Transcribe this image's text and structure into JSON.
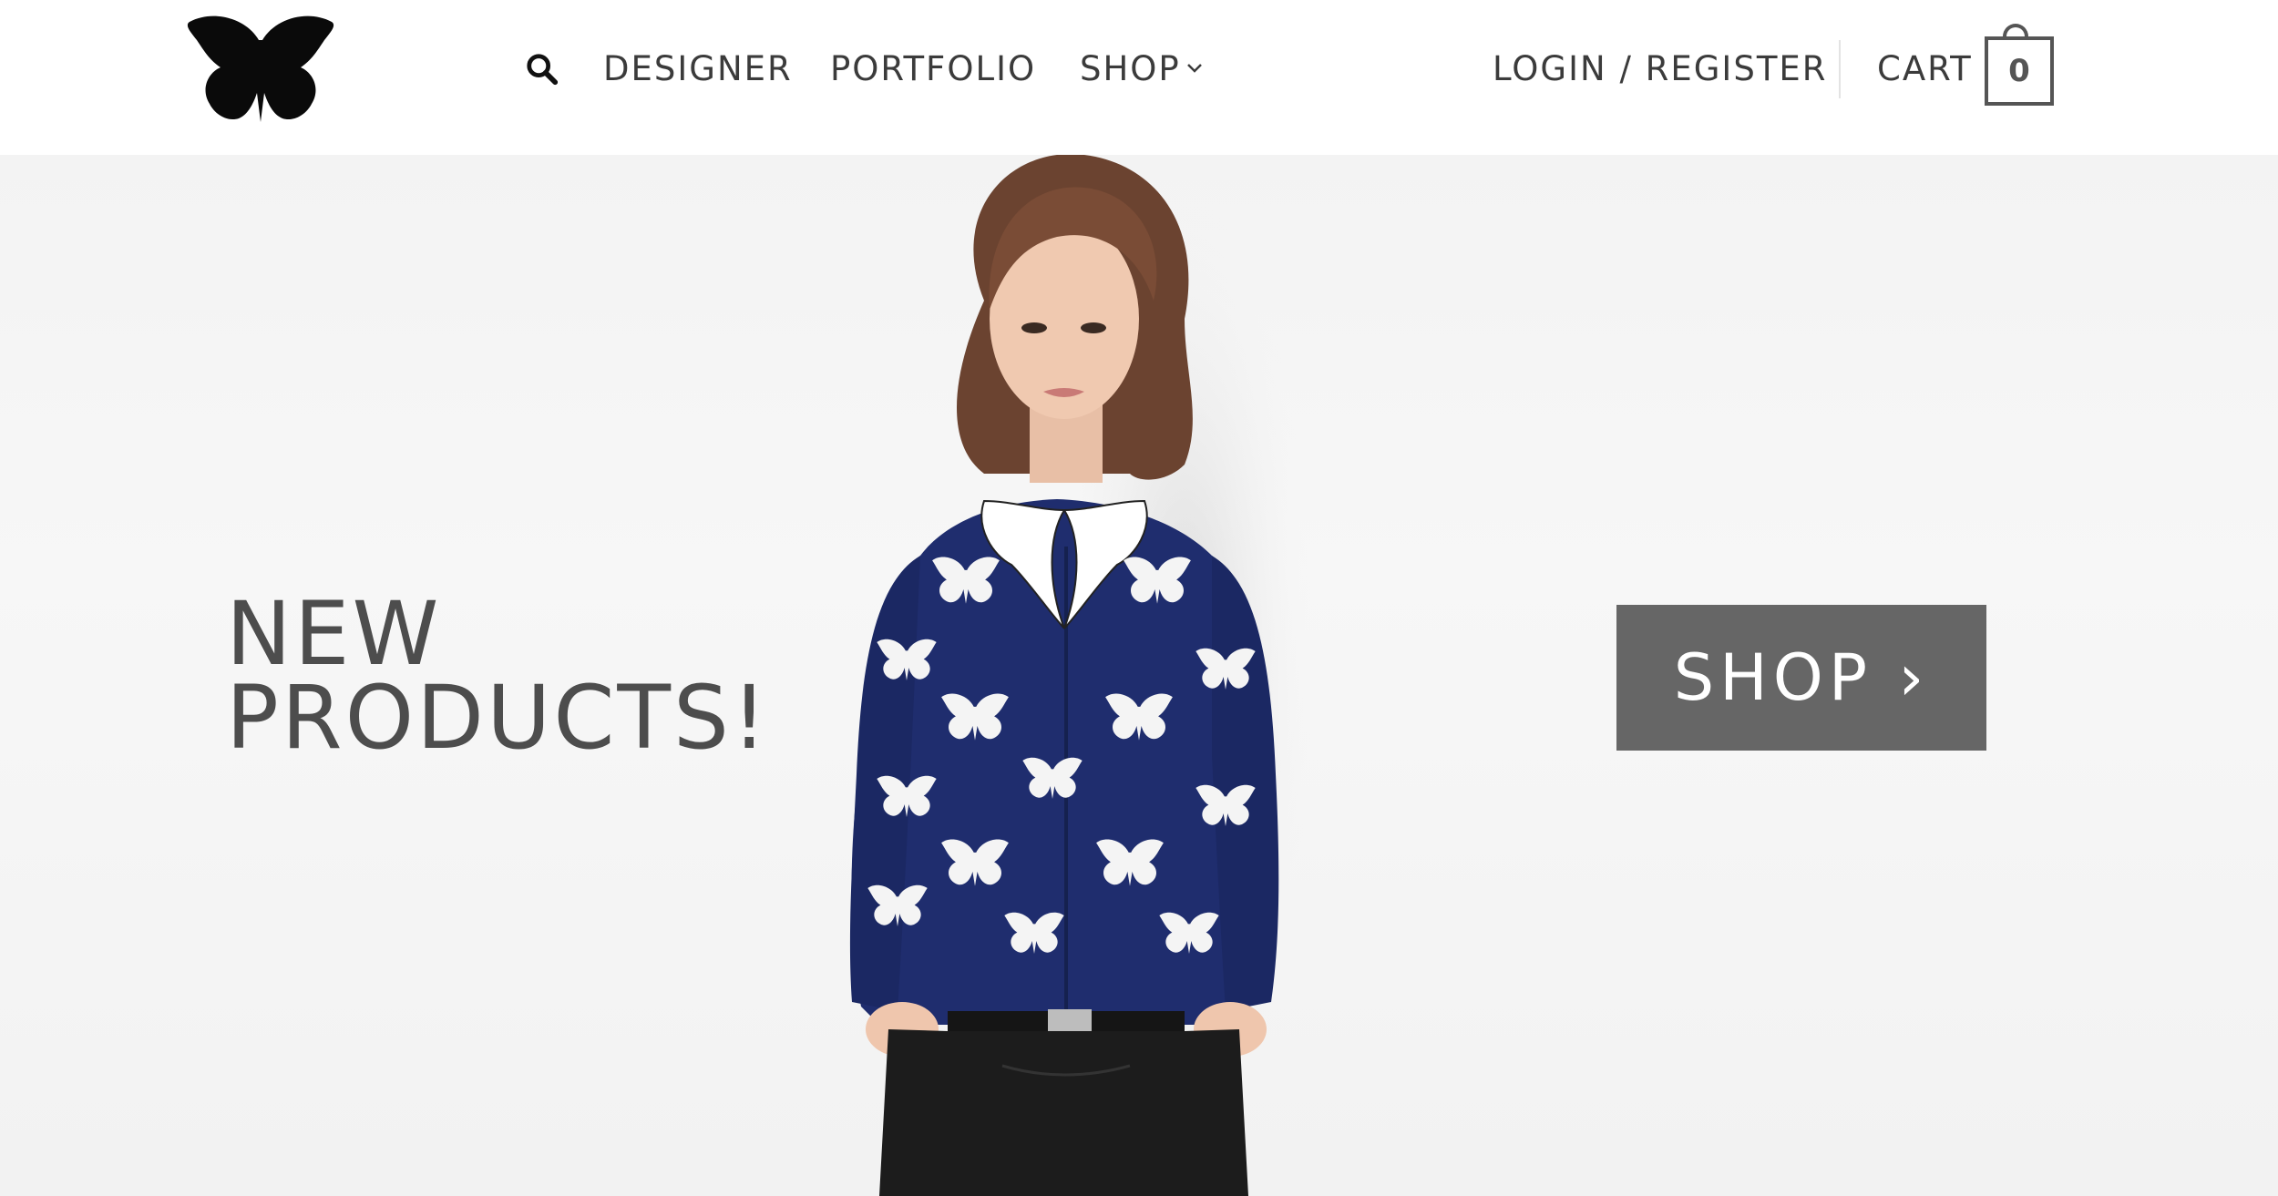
{
  "header": {
    "logo_icon": "butterfly-logo-icon",
    "search_icon": "search-icon",
    "nav": {
      "designer": "DESIGNER",
      "portfolio": "PORTFOLIO",
      "shop": "SHOP",
      "login_register": "LOGIN / REGISTER",
      "cart": "CART"
    },
    "cart_count": "0"
  },
  "hero": {
    "title": "NEW\nPRODUCTS!",
    "shop_button": "SHOP ›",
    "image": "model-in-butterfly-cardigan"
  },
  "colors": {
    "text": "#3b3b3b",
    "hero_title": "#4d4d4d",
    "button_bg": "#666666",
    "cardigan": "#1f2d6e"
  }
}
